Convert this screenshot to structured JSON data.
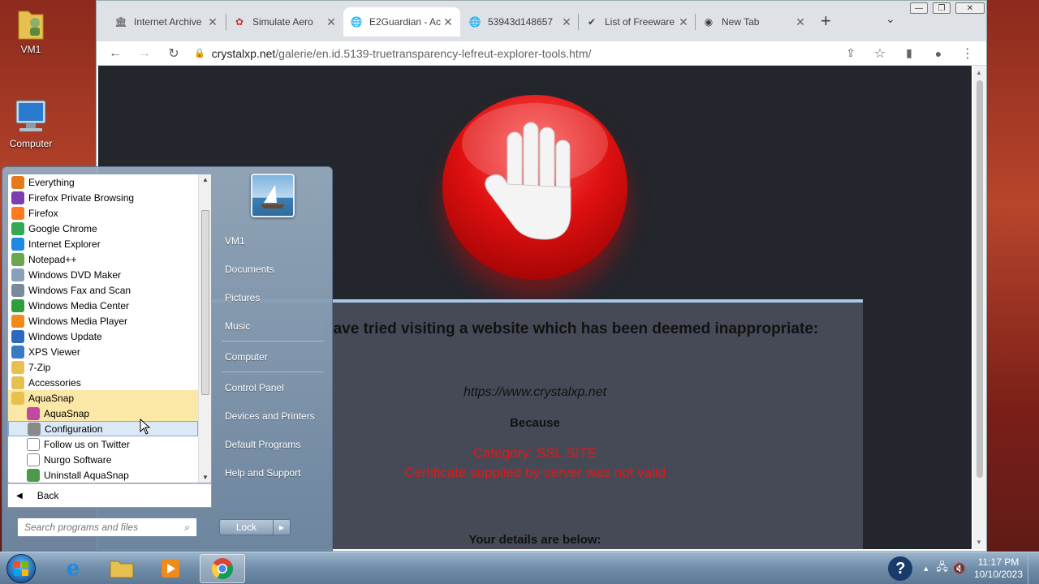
{
  "desktop": {
    "icons": [
      {
        "label": "VM1"
      },
      {
        "label": "Computer"
      }
    ]
  },
  "browser": {
    "tabs": [
      {
        "title": "Internet Archive",
        "icon": "archive-icon"
      },
      {
        "title": "Simulate Aero",
        "icon": "puzzle-icon"
      },
      {
        "title": "E2Guardian - Ac",
        "icon": "globe-icon",
        "active": true
      },
      {
        "title": "53943d148657",
        "icon": "globe-icon"
      },
      {
        "title": "List of Freeware",
        "icon": "bookmark-icon"
      },
      {
        "title": "New Tab",
        "icon": "chrome-icon"
      }
    ],
    "new_tab": "+",
    "address": {
      "host": "crystalxp.net",
      "path": "/galerie/en.id.5139-truetransparency-lefreut-explorer-tools.htm/"
    }
  },
  "page": {
    "heading": "have tried visiting a website which has been deemed inappropriate:",
    "site": "https://www.crystalxp.net",
    "because": "Because",
    "category": "Category: SSL SITE",
    "reason": "Certificate supplied by server was not valid",
    "details": "Your details are below:"
  },
  "startmenu": {
    "programs": [
      {
        "label": "Everything",
        "icon": "search-icon",
        "color": "#e57a1a"
      },
      {
        "label": "Firefox Private Browsing",
        "icon": "mask-icon",
        "color": "#7a3fb0"
      },
      {
        "label": "Firefox",
        "icon": "firefox-icon",
        "color": "#ff7a1a"
      },
      {
        "label": "Google Chrome",
        "icon": "chrome-icon",
        "color": "#34a853"
      },
      {
        "label": "Internet Explorer",
        "icon": "ie-icon",
        "color": "#1e88e5"
      },
      {
        "label": "Notepad++",
        "icon": "notepad-icon",
        "color": "#6aa84f"
      },
      {
        "label": "Windows DVD Maker",
        "icon": "dvd-icon",
        "color": "#8aa0b8"
      },
      {
        "label": "Windows Fax and Scan",
        "icon": "fax-icon",
        "color": "#7a8a9a"
      },
      {
        "label": "Windows Media Center",
        "icon": "media-center-icon",
        "color": "#2e9e3e"
      },
      {
        "label": "Windows Media Player",
        "icon": "media-player-icon",
        "color": "#f08a1a"
      },
      {
        "label": "Windows Update",
        "icon": "update-icon",
        "color": "#2a6ac0"
      },
      {
        "label": "XPS Viewer",
        "icon": "xps-icon",
        "color": "#3a7ac0"
      },
      {
        "label": "7-Zip",
        "icon": "folder-icon",
        "color": "#e8c050"
      },
      {
        "label": "Accessories",
        "icon": "folder-icon",
        "color": "#e8c050"
      },
      {
        "label": "AquaSnap",
        "icon": "folder-icon",
        "color": "#e8c050",
        "highlight": true
      },
      {
        "label": "AquaSnap",
        "icon": "aquasnap-icon",
        "color": "#c04aa0",
        "sub": true,
        "highlight": true
      },
      {
        "label": "Configuration",
        "icon": "config-icon",
        "color": "#8a8a8a",
        "sub": true,
        "selected": true
      },
      {
        "label": "Follow us on Twitter",
        "icon": "document-icon",
        "color": "#ffffff",
        "sub": true
      },
      {
        "label": "Nurgo Software",
        "icon": "document-icon",
        "color": "#ffffff",
        "sub": true
      },
      {
        "label": "Uninstall AquaSnap",
        "icon": "uninstall-icon",
        "color": "#4a9a4a",
        "sub": true
      }
    ],
    "back": "Back",
    "search_placeholder": "Search programs and files",
    "right_items": [
      "VM1",
      "Documents",
      "Pictures",
      "Music",
      "Computer",
      "Control Panel",
      "Devices and Printers",
      "Default Programs",
      "Help and Support"
    ],
    "lock": "Lock"
  },
  "taskbar": {
    "time": "11:17 PM",
    "date": "10/10/2023"
  }
}
